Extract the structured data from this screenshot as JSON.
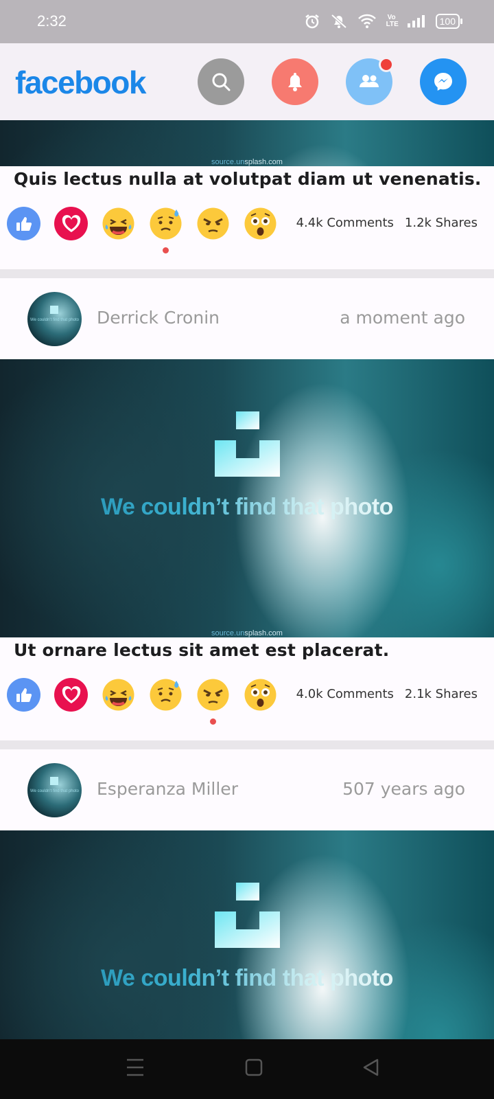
{
  "status_bar": {
    "time": "2:32",
    "battery": "100",
    "network_label": "Vo LTE"
  },
  "app": {
    "logo": "facebook"
  },
  "header_buttons": [
    {
      "name": "search",
      "icon": "search-icon"
    },
    {
      "name": "notifications",
      "icon": "bell-icon"
    },
    {
      "name": "friends",
      "icon": "friends-icon",
      "has_badge": true
    },
    {
      "name": "messenger",
      "icon": "messenger-icon"
    }
  ],
  "photo": {
    "message": "We couldn’t find that photo",
    "source_prefix": "source.un",
    "source_suffix": "splash.com"
  },
  "reactions": [
    "like",
    "love",
    "haha",
    "sad",
    "angry",
    "wow"
  ],
  "posts": [
    {
      "caption": "Quis lectus nulla at volutpat diam ut venenatis.",
      "comments": "4.4k Comments",
      "shares": "1.2k Shares",
      "selected_reaction": "sad"
    },
    {
      "author": "Derrick Cronin",
      "time": "a moment ago",
      "caption": "Ut ornare lectus sit amet est placerat.",
      "comments": "4.0k Comments",
      "shares": "2.1k Shares",
      "selected_reaction": "angry"
    },
    {
      "author": "Esperanza Miller",
      "time": "507 years ago"
    }
  ],
  "colors": {
    "brand": "#1b87e8",
    "accent_red": "#ef3f3a",
    "like_blue": "#5b94f3",
    "love_red": "#e8114f"
  }
}
